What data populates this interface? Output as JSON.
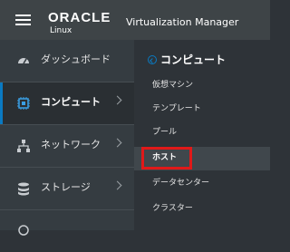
{
  "header": {
    "brand": "ORACLE",
    "brand_sub": "Linux",
    "app_title": "Virtualization Manager"
  },
  "sidebar": {
    "items": [
      {
        "label": "ダッシュボード",
        "icon": "dashboard-icon"
      },
      {
        "label": "コンピュート",
        "icon": "chip-icon",
        "selected": true
      },
      {
        "label": "ネットワーク",
        "icon": "network-icon"
      },
      {
        "label": "ストレージ",
        "icon": "storage-icon"
      }
    ]
  },
  "panel": {
    "title": "コンピュート",
    "items": [
      {
        "label": "仮想マシン"
      },
      {
        "label": "テンプレート"
      },
      {
        "label": "プール"
      },
      {
        "label": "ホスト",
        "active": true
      },
      {
        "label": "データセンター"
      },
      {
        "label": "クラスター"
      }
    ]
  },
  "colors": {
    "header_bg": "#3e4447",
    "sidebar_bg": "#353c41",
    "panel_bg": "#2e3338",
    "accent": "#0a7ac2",
    "highlight": "#e01919"
  }
}
